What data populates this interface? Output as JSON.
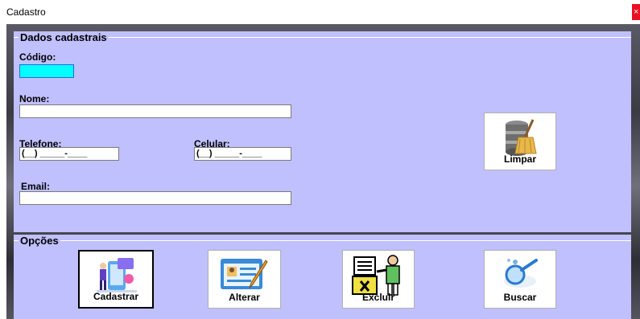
{
  "window": {
    "title": "Cadastro",
    "close_glyph": "×"
  },
  "dados": {
    "legend": "Dados cadastrais",
    "codigo_label": "Código:",
    "codigo_value": "",
    "nome_label": "Nome:",
    "nome_value": "",
    "telefone_label": "Telefone:",
    "telefone_mask": "(__) _____-____",
    "celular_label": "Celular:",
    "celular_mask": "(__) _____-____",
    "email_label": "Email:",
    "email_value": "",
    "limpar_label": "Limpar"
  },
  "opcoes": {
    "legend": "Opções",
    "buttons": [
      {
        "label": "Cadastrar",
        "icon": "register-icon"
      },
      {
        "label": "Alterar",
        "icon": "edit-icon"
      },
      {
        "label": "Excluir",
        "icon": "delete-ballot-icon"
      },
      {
        "label": "Buscar",
        "icon": "search-icon"
      }
    ]
  },
  "colors": {
    "panel": "#c0c0ff",
    "active_field": "#00ffff",
    "close": "#e81123"
  }
}
